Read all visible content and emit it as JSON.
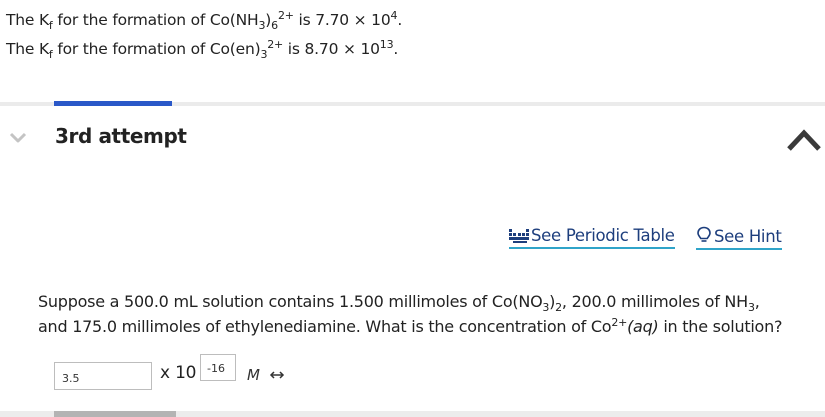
{
  "given": {
    "line1": {
      "pre": "The K",
      "sub_f": "f",
      "mid": " for the formation of Co(NH",
      "sub_3": "3",
      "close": ")",
      "sub_6": "6",
      "charge": "2+",
      "is": " is 7.70 × 10",
      "exp": "4",
      "end": "."
    },
    "line2": {
      "pre": "The K",
      "sub_f": "f",
      "mid": " for the formation of Co(en)",
      "sub_3": "3",
      "charge": "2+",
      "is": " is 8.70 × 10",
      "exp": "13",
      "end": "."
    }
  },
  "attempt": {
    "label": "3rd attempt"
  },
  "links": {
    "periodic_table": "See Periodic Table",
    "hint": "See Hint"
  },
  "question": {
    "p1": "Suppose a 500.0 mL solution contains 1.500 millimoles of Co(NO",
    "s1": "3",
    "p2": ")",
    "s2": "2",
    "p3": ", 200.0 millimoles of NH",
    "s3": "3",
    "p4": ",",
    "line2_a": "and 175.0 millimoles of ethylenediamine. What is the concentration of Co",
    "sup": "2+",
    "aq": "(aq)",
    "line2_b": " in the solution?"
  },
  "answer": {
    "value": "3.5",
    "times": "x 10",
    "exponent": "-16",
    "unit": "M"
  },
  "colors": {
    "accent_blue": "#2a58c8",
    "link_underline": "#2fa4c9",
    "link_text": "#1d3e7d"
  }
}
